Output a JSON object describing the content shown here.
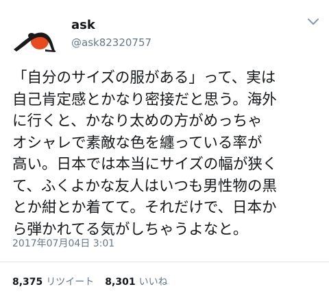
{
  "user": {
    "display_name": "ask",
    "handle": "@ask82320757",
    "avatar_icon": "yoga-pose-silhouette-icon"
  },
  "menu_icon": "chevron-down-icon",
  "tweet": {
    "lines": [
      "「自分のサイズの服がある」って、実は",
      "自己肯定感とかなり密接だと思う。海外",
      "に行くと、かなり太めの方がめっちゃ",
      "オシャレで素敵な色を纏っている率が",
      "高い。日本では本当にサイズの幅が狭く",
      "て、ふくよかな友人はいつも男性物の黒",
      "とか紺とか着てて。それだけで、日本か",
      "ら弾かれてる気がしちゃうよなと。"
    ],
    "timestamp": "2017年07月04日 3:01"
  },
  "stats": {
    "retweets_count": "8,375",
    "retweets_label": "リツイート",
    "likes_count": "8,301",
    "likes_label": "いいね"
  },
  "colors": {
    "text": "#14171a",
    "secondary": "#657786",
    "divider": "#e1e8ed",
    "avatar_accent": "#e8491d"
  }
}
